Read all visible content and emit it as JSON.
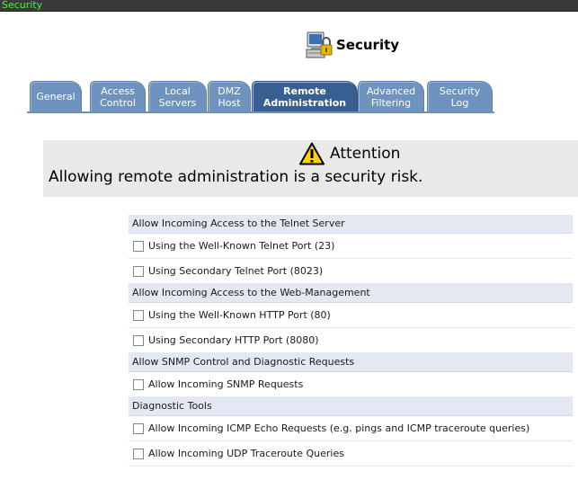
{
  "window": {
    "title": "Security"
  },
  "header": {
    "title": "Security",
    "icon": "lock-computer-icon"
  },
  "tabs": [
    {
      "id": "general",
      "line1": "General",
      "line2": "",
      "active": false
    },
    {
      "id": "access-control",
      "line1": "Access",
      "line2": "Control",
      "active": false
    },
    {
      "id": "local-servers",
      "line1": "Local",
      "line2": "Servers",
      "active": false
    },
    {
      "id": "dmz-host",
      "line1": "DMZ",
      "line2": "Host",
      "active": false
    },
    {
      "id": "remote-administration",
      "line1": "Remote",
      "line2": "Administration",
      "active": true
    },
    {
      "id": "advanced-filtering",
      "line1": "Advanced",
      "line2": "Filtering",
      "active": false
    },
    {
      "id": "security-log",
      "line1": "Security",
      "line2": "Log",
      "active": false
    }
  ],
  "attention": {
    "title": "Attention",
    "icon": "warning-triangle-icon",
    "message": "Allowing remote administration is a security risk."
  },
  "sections": [
    {
      "heading": "Allow Incoming Access to the Telnet Server",
      "items": [
        {
          "label": "Using the Well-Known Telnet Port (23)",
          "checked": false
        },
        {
          "label": "Using Secondary Telnet Port (8023)",
          "checked": false
        }
      ]
    },
    {
      "heading": "Allow Incoming Access to the Web-Management",
      "items": [
        {
          "label": "Using the Well-Known HTTP Port (80)",
          "checked": false
        },
        {
          "label": "Using Secondary HTTP Port (8080)",
          "checked": false
        }
      ]
    },
    {
      "heading": "Allow SNMP Control and Diagnostic Requests",
      "items": [
        {
          "label": "Allow Incoming SNMP Requests",
          "checked": false
        }
      ]
    },
    {
      "heading": "Diagnostic Tools",
      "items": [
        {
          "label": "Allow Incoming ICMP Echo Requests (e.g. pings and ICMP traceroute queries)",
          "checked": false
        },
        {
          "label": "Allow Incoming UDP Traceroute Queries",
          "checked": false
        }
      ]
    }
  ],
  "colors": {
    "tab": "#6f93bf",
    "tab_active": "#375f92",
    "section_header_bg": "#e4e8f2",
    "attention_bg": "#e9e9e9",
    "titlebar_text": "#32ff32"
  }
}
